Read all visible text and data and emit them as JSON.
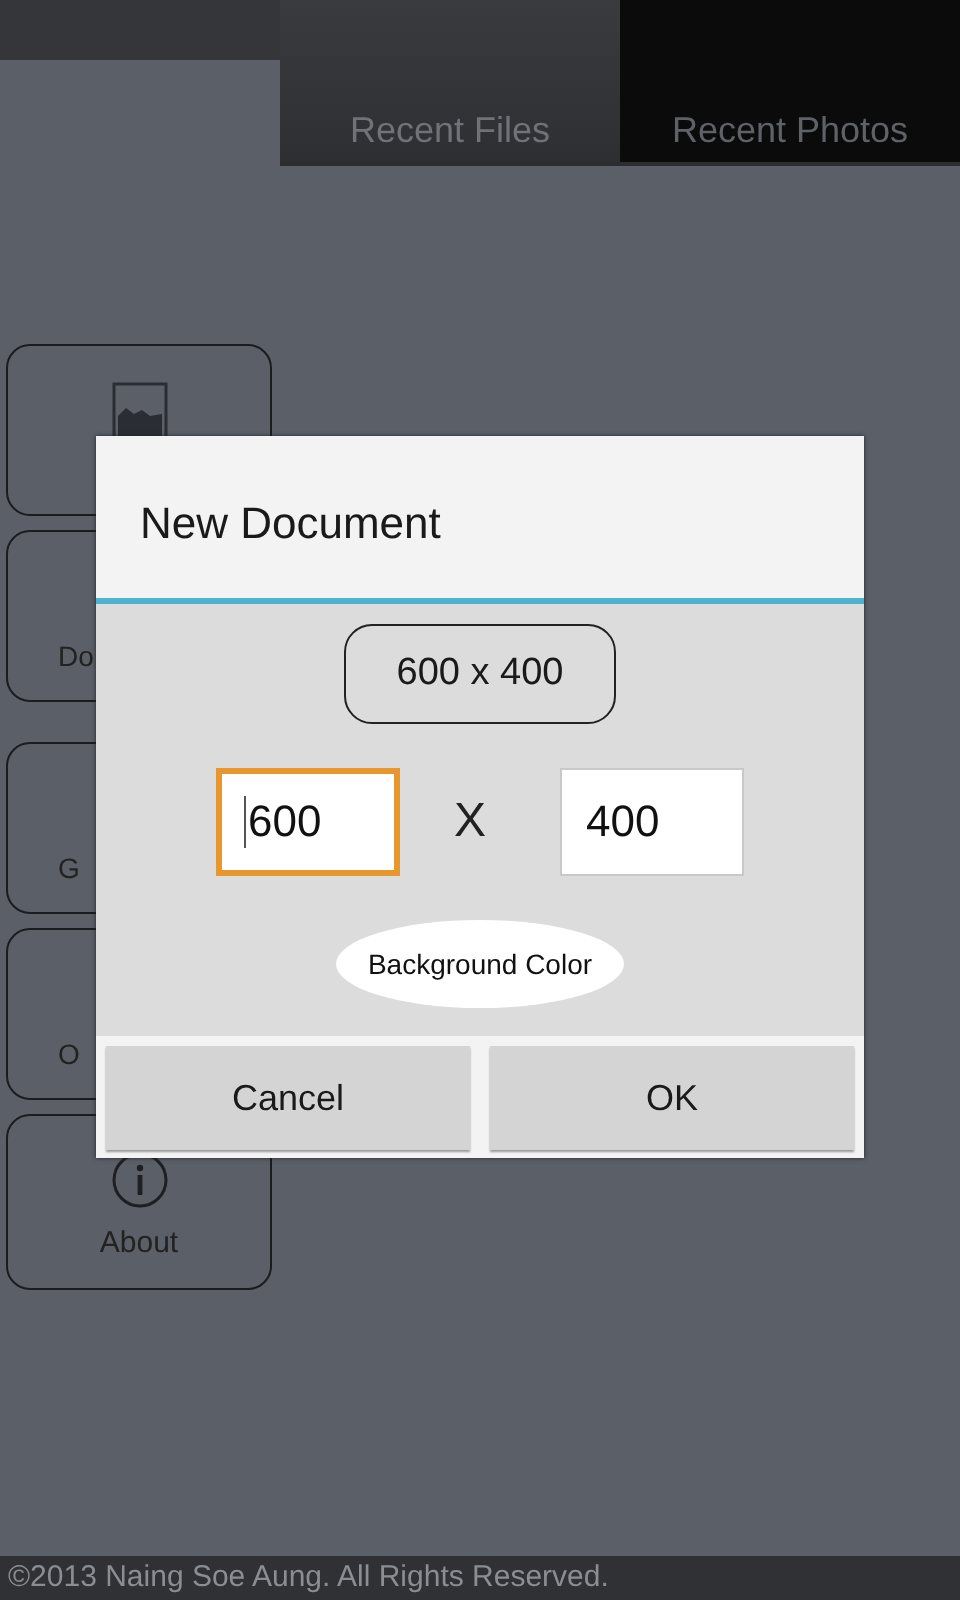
{
  "tabs": [
    {
      "label": "Recent Files",
      "selected": true
    },
    {
      "label": "Recent Photos",
      "selected": false
    }
  ],
  "sidebar": {
    "items": [
      {
        "kind": "image"
      },
      {
        "kind": "partial",
        "label": "Do"
      },
      {
        "kind": "partial",
        "label": "G"
      },
      {
        "kind": "partial",
        "label": "O"
      },
      {
        "kind": "info",
        "label": "About"
      }
    ]
  },
  "dialog": {
    "title": "New Document",
    "size_label": "600 x 400",
    "fields": [
      {
        "value": "600",
        "focused": true
      },
      {
        "value": "400",
        "focused": false
      }
    ],
    "separator": "X",
    "color_button": "Background Color",
    "buttons": [
      "Cancel",
      "OK"
    ]
  },
  "footer": "©2013 Naing Soe Aung. All Rights Reserved."
}
